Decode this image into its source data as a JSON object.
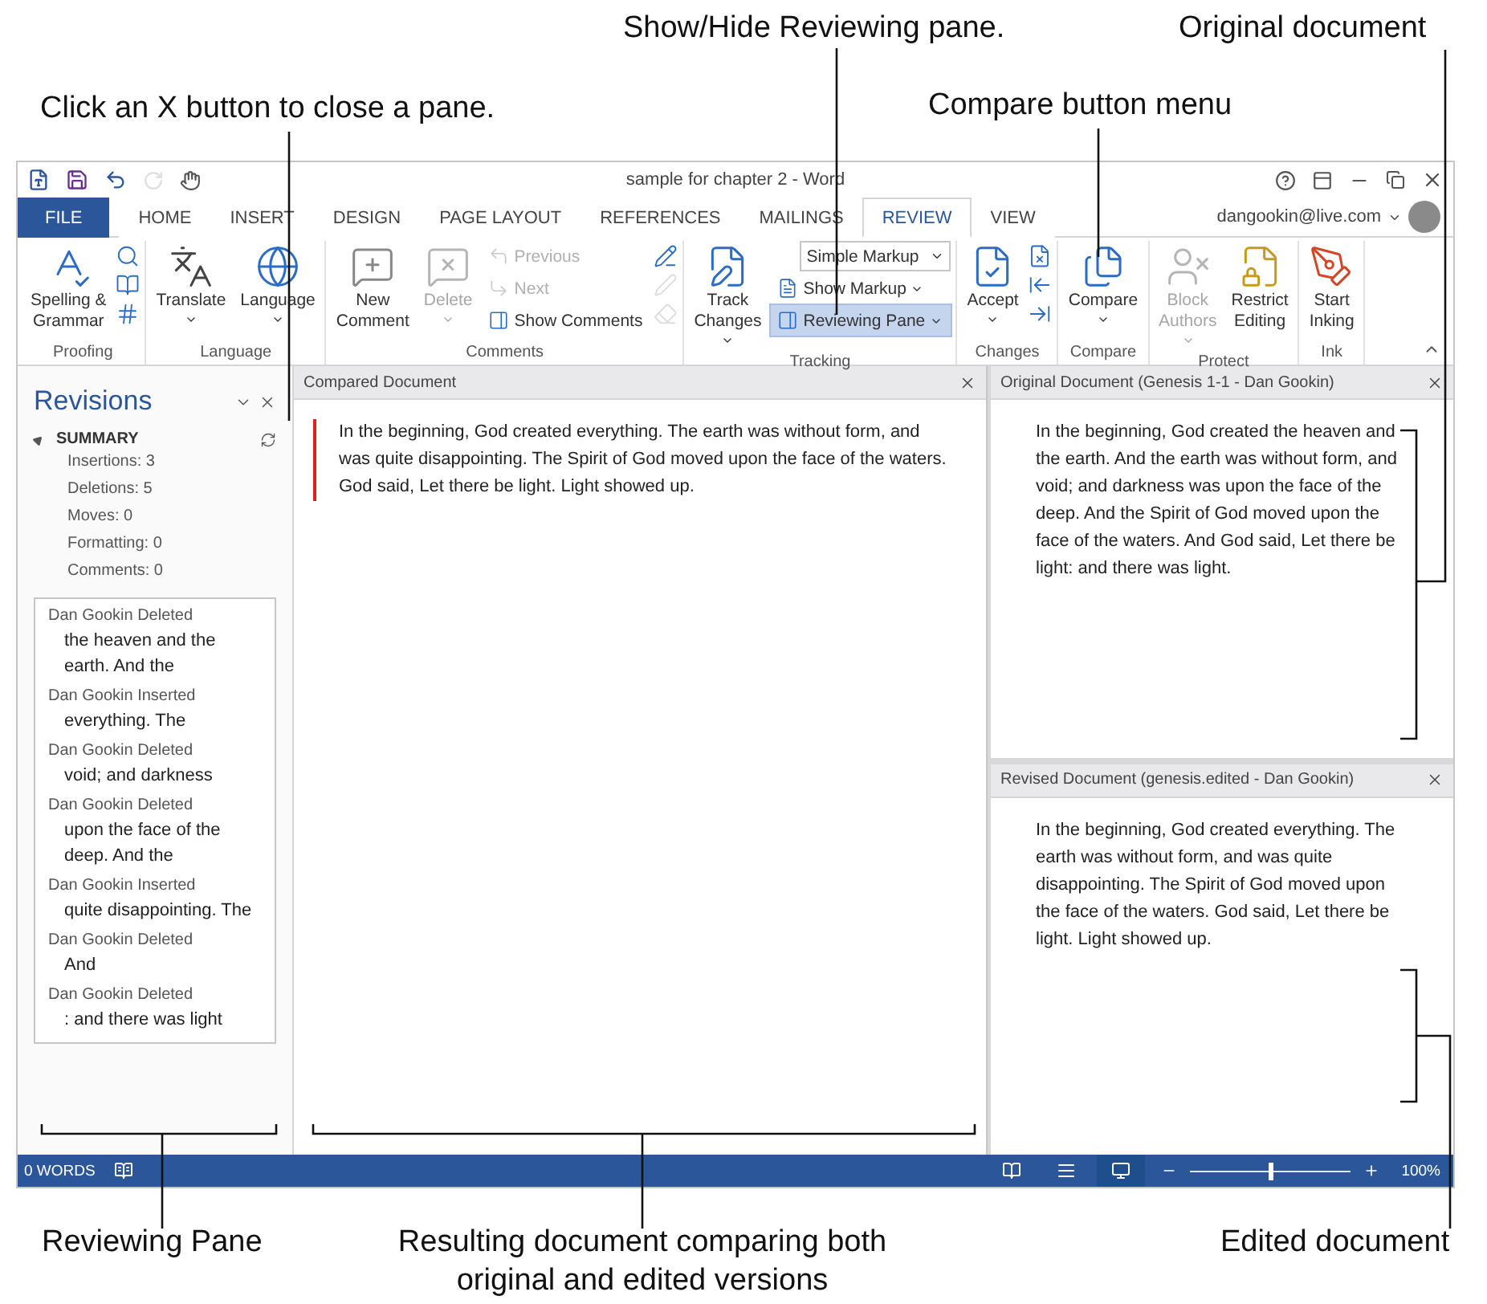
{
  "callouts_top": [
    {
      "text": "Show/Hide Reviewing pane."
    },
    {
      "text": "Original document"
    },
    {
      "text": "Click an X button to close a pane."
    },
    {
      "text": "Compare button menu"
    }
  ],
  "window": {
    "title": "sample for chapter 2 - Word",
    "account": "dangookin@live.com"
  },
  "tabs": [
    {
      "kind": "file",
      "label": "FILE",
      "selected": false
    },
    {
      "kind": "tab",
      "label": "HOME",
      "selected": false
    },
    {
      "kind": "tab",
      "label": "INSERT",
      "selected": false
    },
    {
      "kind": "tab",
      "label": "DESIGN",
      "selected": false
    },
    {
      "kind": "tab",
      "label": "PAGE LAYOUT",
      "selected": false
    },
    {
      "kind": "tab",
      "label": "REFERENCES",
      "selected": false
    },
    {
      "kind": "tab",
      "label": "MAILINGS",
      "selected": false
    },
    {
      "kind": "tab",
      "label": "REVIEW",
      "selected": true
    },
    {
      "kind": "tab",
      "label": "VIEW",
      "selected": false
    }
  ],
  "ribbon": {
    "groups": [
      {
        "label": "Proofing",
        "columns": [
          {
            "kind": "large",
            "label": "Spelling &\nGrammar",
            "disabled": false,
            "dropdown": false
          },
          {
            "kind": "icons",
            "items": [
              {
                "disabled": false
              },
              {
                "disabled": false
              },
              {
                "disabled": false
              }
            ]
          }
        ]
      },
      {
        "label": "Language",
        "columns": [
          {
            "kind": "large",
            "label": "Translate",
            "disabled": false,
            "dropdown": true
          },
          {
            "kind": "large",
            "label": "Language",
            "disabled": false,
            "dropdown": true
          }
        ]
      },
      {
        "label": "Comments",
        "columns": [
          {
            "kind": "large",
            "label": "New\nComment",
            "disabled": false,
            "dropdown": false
          },
          {
            "kind": "large",
            "label": "Delete",
            "disabled": true,
            "dropdown": true
          },
          {
            "kind": "stack",
            "items": [
              {
                "kind": "button",
                "label": "Previous",
                "disabled": true,
                "dropdown": false,
                "selected": false
              },
              {
                "kind": "button",
                "label": "Next",
                "disabled": true,
                "dropdown": false,
                "selected": false
              },
              {
                "kind": "button",
                "label": "Show Comments",
                "disabled": false,
                "dropdown": false,
                "selected": false
              }
            ]
          },
          {
            "kind": "icons",
            "items": [
              {
                "disabled": false
              },
              {
                "disabled": true
              },
              {
                "disabled": true
              }
            ]
          }
        ]
      },
      {
        "label": "Tracking",
        "columns": [
          {
            "kind": "large",
            "label": "Track\nChanges",
            "disabled": false,
            "dropdown": true
          },
          {
            "kind": "stack",
            "items": [
              {
                "kind": "select",
                "label": "Simple Markup",
                "dropdown": true
              },
              {
                "kind": "button",
                "label": "Show Markup",
                "disabled": false,
                "dropdown": true,
                "selected": false
              },
              {
                "kind": "button",
                "label": "Reviewing Pane",
                "disabled": false,
                "dropdown": true,
                "selected": true
              }
            ]
          }
        ]
      },
      {
        "label": "Changes",
        "columns": [
          {
            "kind": "large",
            "label": "Accept",
            "disabled": false,
            "dropdown": true
          },
          {
            "kind": "icons",
            "items": [
              {
                "disabled": false
              },
              {
                "disabled": false
              },
              {
                "disabled": false
              }
            ]
          }
        ]
      },
      {
        "label": "Compare",
        "columns": [
          {
            "kind": "large",
            "label": "Compare",
            "disabled": false,
            "dropdown": true
          }
        ]
      },
      {
        "label": "Protect",
        "columns": [
          {
            "kind": "large",
            "label": "Block\nAuthors",
            "disabled": true,
            "dropdown": true
          },
          {
            "kind": "large",
            "label": "Restrict\nEditing",
            "disabled": false,
            "dropdown": false
          }
        ]
      },
      {
        "label": "Ink",
        "columns": [
          {
            "kind": "large",
            "label": "Start\nInking",
            "disabled": false,
            "dropdown": false
          }
        ]
      }
    ]
  },
  "revisions_pane": {
    "title": "Revisions",
    "summary": {
      "heading": "SUMMARY",
      "expanded": true,
      "stats": [
        "Insertions: 3",
        "Deletions: 5",
        "Moves: 0",
        "Formatting: 0",
        "Comments: 0"
      ]
    },
    "revisions": [
      {
        "header": "Dan Gookin Deleted",
        "text": "the heaven and the earth. And the"
      },
      {
        "header": "Dan Gookin Inserted",
        "text": "everything. The"
      },
      {
        "header": "Dan Gookin Deleted",
        "text": "void; and darkness"
      },
      {
        "header": "Dan Gookin Deleted",
        "text": "upon the face of the deep. And the"
      },
      {
        "header": "Dan Gookin Inserted",
        "text": "quite disappointing. The"
      },
      {
        "header": "Dan Gookin Deleted",
        "text": "And"
      },
      {
        "header": "Dan Gookin Deleted",
        "text": ": and there was light"
      }
    ]
  },
  "documents": [
    {
      "title": "Compared Document",
      "text": "In the beginning, God created everything. The earth was without form, and was quite disappointing. The Spirit of God moved upon the face of the waters. God said, Let there be light. Light showed up."
    },
    {
      "title": "Original Document (Genesis 1-1 - Dan Gookin)",
      "text": "In the beginning, God created the heaven and the earth. And the earth was without form, and void; and darkness was upon the face of the deep. And the Spirit of God moved upon the face of the waters. And God said, Let there be light: and there was light."
    },
    {
      "title": "Revised Document (genesis.edited - Dan Gookin)",
      "text": "In the beginning, God created everything. The earth was without form, and was quite disappointing. The Spirit of God moved upon the face of the waters. God said, Let there be light. Light showed up."
    }
  ],
  "status_bar": {
    "words": "0 WORDS",
    "views": [
      {
        "selected": false
      },
      {
        "selected": false
      },
      {
        "selected": true
      }
    ],
    "zoom": {
      "level": 0.5,
      "reading": "100%"
    }
  },
  "callouts_bottom": [
    {
      "text": "Reviewing Pane"
    },
    {
      "text": "Resulting document comparing both original and edited versions"
    },
    {
      "text": "Edited document"
    }
  ]
}
